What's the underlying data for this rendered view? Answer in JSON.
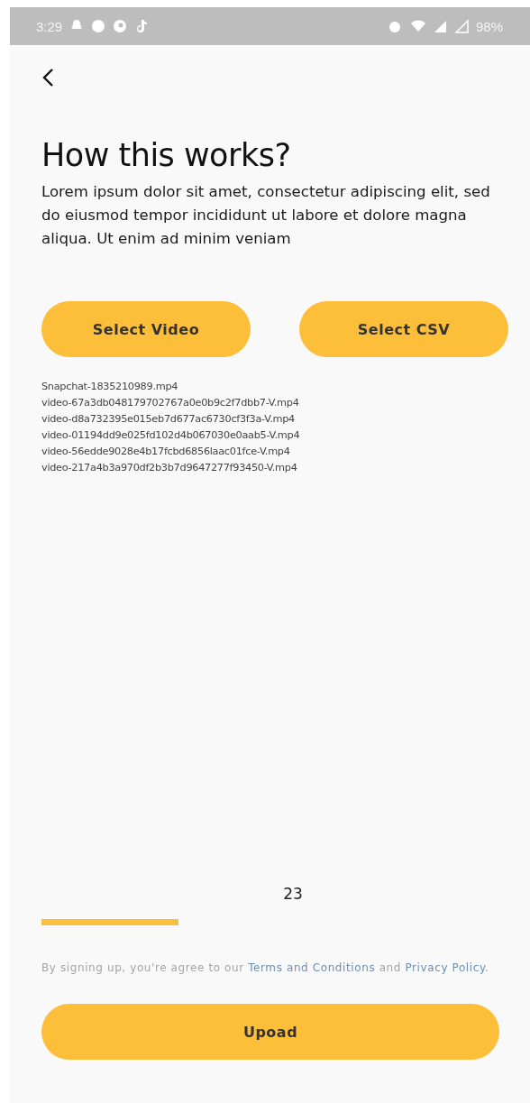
{
  "status_bar": {
    "time": "3:29",
    "battery": "98%"
  },
  "title": "How this works?",
  "description": "Lorem ipsum dolor sit amet, consectetur adipiscing elit, sed do eiusmod tempor incididunt ut labore et dolore magna aliqua. Ut enim ad minim veniam",
  "buttons": [
    "Select Video",
    "Select CSV"
  ],
  "files": [
    "Snapchat-1835210989.mp4",
    "video-67a3db048179702767a0e0b9c2f7dbb7-V.mp4",
    "video-d8a732395e015eb7d677ac6730cf3f3a-V.mp4",
    "video-01194dd9e025fd102d4b067030e0aab5-V.mp4",
    "video-56edde9028e4b17fcbd6856laac01fce-V.mp4",
    "video-217a4b3a970df2b3b7d9647277f93450-V.mp4"
  ],
  "count": "23",
  "progress": {
    "level": 0.3
  },
  "terms": [
    {
      "kind": "text",
      "text": "By signing up, you're agree to our "
    },
    {
      "kind": "link",
      "text": "Terms and Conditions"
    },
    {
      "kind": "text",
      "text": " and "
    },
    {
      "kind": "link",
      "text": "Privacy Policy"
    },
    {
      "kind": "text",
      "text": "."
    }
  ],
  "upload_button": "Upoad"
}
